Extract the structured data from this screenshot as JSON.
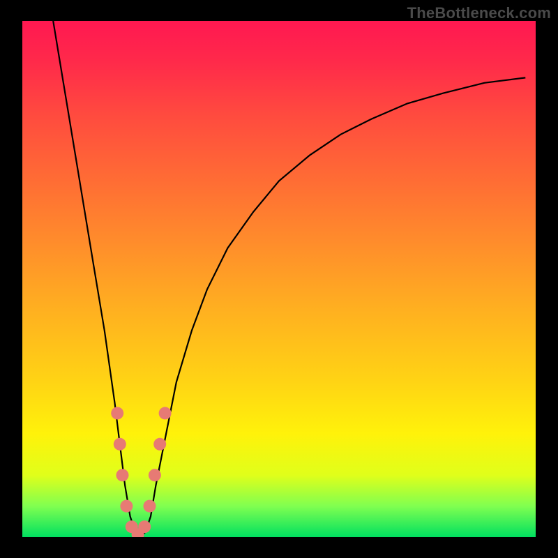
{
  "watermark": "TheBottleneck.com",
  "chart_data": {
    "type": "line",
    "title": "",
    "xlabel": "",
    "ylabel": "",
    "xlim": [
      0,
      100
    ],
    "ylim": [
      0,
      100
    ],
    "series": [
      {
        "name": "curve",
        "x": [
          6,
          8,
          10,
          12,
          14,
          16,
          18,
          19,
          20,
          21,
          22,
          23,
          24,
          25,
          26,
          28,
          30,
          33,
          36,
          40,
          45,
          50,
          56,
          62,
          68,
          75,
          82,
          90,
          98
        ],
        "y": [
          100,
          88,
          76,
          64,
          52,
          40,
          26,
          18,
          10,
          4,
          1,
          0,
          1,
          4,
          10,
          20,
          30,
          40,
          48,
          56,
          63,
          69,
          74,
          78,
          81,
          84,
          86,
          88,
          89
        ]
      }
    ],
    "markers": [
      {
        "x": 18.5,
        "y": 24
      },
      {
        "x": 19.0,
        "y": 18
      },
      {
        "x": 19.5,
        "y": 12
      },
      {
        "x": 20.3,
        "y": 6
      },
      {
        "x": 21.3,
        "y": 2
      },
      {
        "x": 22.5,
        "y": 0.5
      },
      {
        "x": 23.8,
        "y": 2
      },
      {
        "x": 24.8,
        "y": 6
      },
      {
        "x": 25.8,
        "y": 12
      },
      {
        "x": 26.8,
        "y": 18
      },
      {
        "x": 27.8,
        "y": 24
      }
    ],
    "gradient_bands": [
      {
        "color": "#ff1851",
        "stop": 0
      },
      {
        "color": "#ff6a35",
        "stop": 30
      },
      {
        "color": "#ffd414",
        "stop": 70
      },
      {
        "color": "#00e060",
        "stop": 100
      }
    ]
  }
}
